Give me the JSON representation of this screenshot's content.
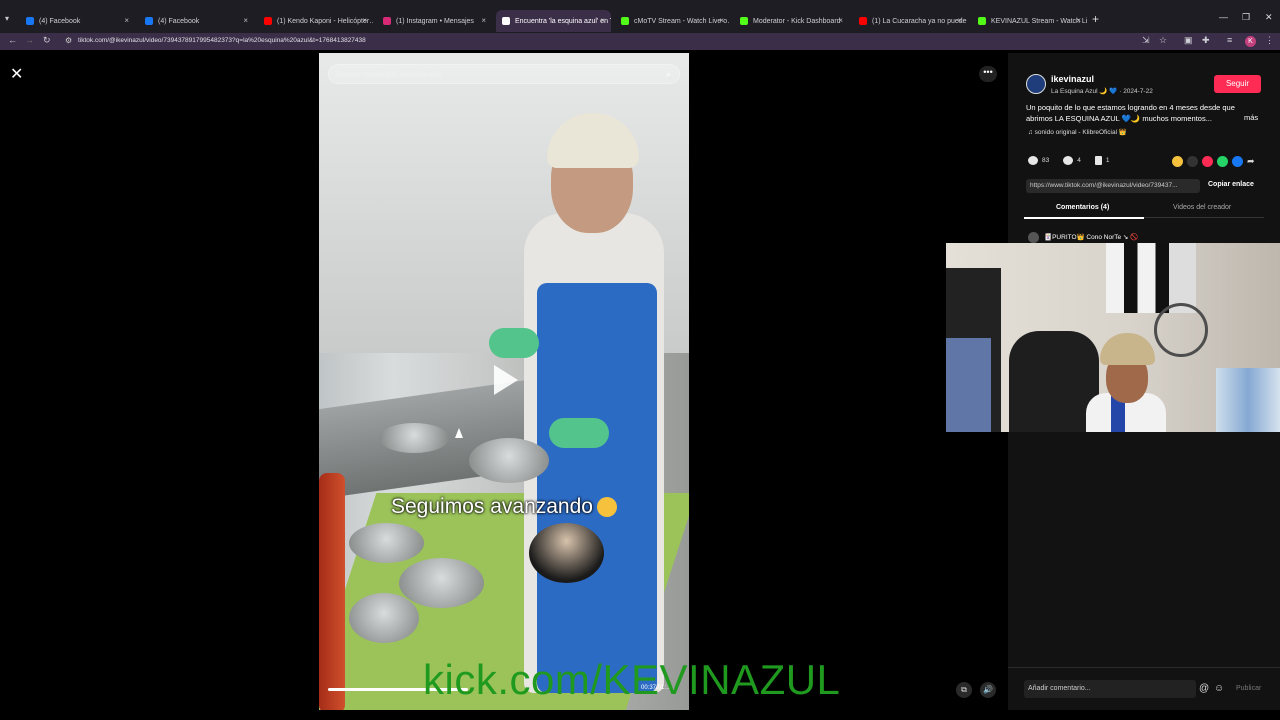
{
  "browser": {
    "tabs": [
      {
        "label": "(4) Facebook",
        "color": "#1877f2"
      },
      {
        "label": "(4) Facebook",
        "color": "#1877f2"
      },
      {
        "label": "(1) Kendo Kaponi - Helicópter…",
        "color": "#ff0000"
      },
      {
        "label": "(1) Instagram • Mensajes",
        "color": "#d62976"
      },
      {
        "label": "Encuentra 'la esquina azul' en T…",
        "color": "#ffffff",
        "active": true
      },
      {
        "label": "cMoTV Stream - Watch Live o…",
        "color": "#53fc18"
      },
      {
        "label": "Moderator - Kick Dashboard",
        "color": "#53fc18"
      },
      {
        "label": "(1) La Cucaracha ya no puede c…",
        "color": "#ff0000"
      },
      {
        "label": "KEVINAZUL Stream - Watch Liv…",
        "color": "#53fc18"
      }
    ],
    "url": "tiktok.com/@ikevinazul/video/7394378917995482373?q=la%20esquina%20azul&t=1768413827438",
    "profile_initial": "K"
  },
  "video": {
    "search_placeholder": "Buscar contenido relacionado",
    "caption": "Seguimos avanzando",
    "time": "00:37/01:…"
  },
  "overlay": {
    "watermark": "kick.com/KEVINAZUL",
    "watermark_color": "#1f9a1f"
  },
  "panel": {
    "channel_name": "ikevinazul",
    "channel_sub": "La Esquina Azul 🌙 💙 · 2024-7-22",
    "follow_label": "Seguir",
    "description": "Un poquito de lo que estamos logrando en 4 meses desde que abrimos LA ESQUINA AZUL 💙🌙 muchos momentos...",
    "more_label": "más",
    "sound": "♫  sonido original - KlibreOficial 👑",
    "likes": "83",
    "comments": "4",
    "saves": "1",
    "link": "https://www.tiktok.com/@ikevinazul/video/739437...",
    "copy_label": "Copiar enlace",
    "tab_comments": "Comentarios (4)",
    "tab_creator": "Videos del creador",
    "first_commenter": "🃏PURITO👑 Cono NorTe ↘ 🚫",
    "comment_placeholder": "Añadir comentario...",
    "publish_label": "Publicar"
  }
}
